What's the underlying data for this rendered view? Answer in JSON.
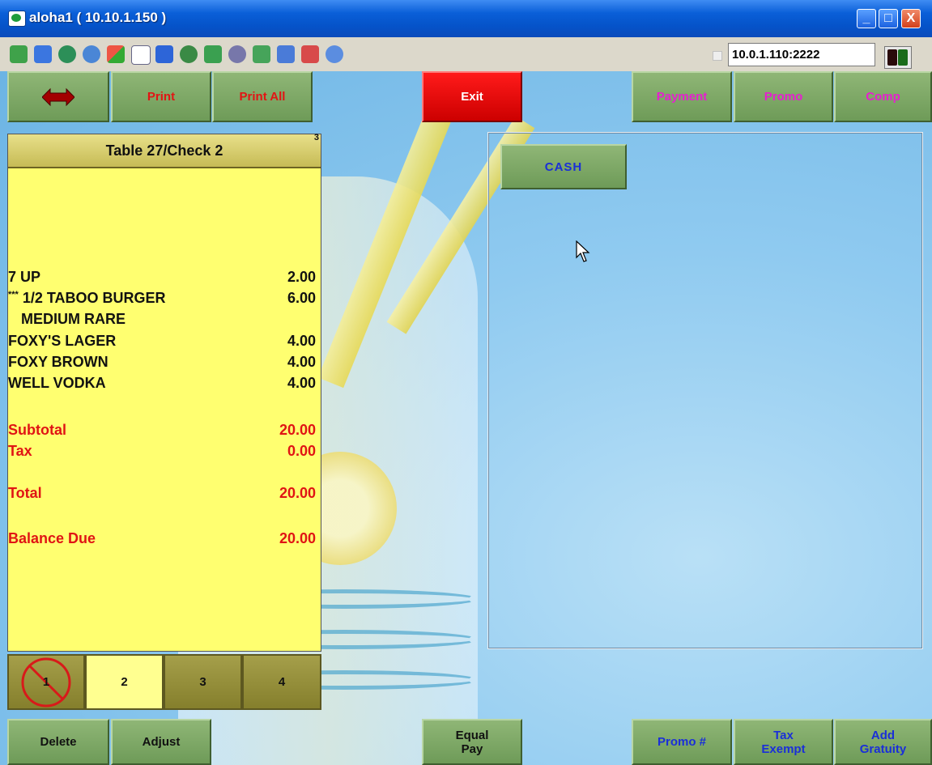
{
  "window": {
    "title": "aloha1 ( 10.10.1.150 )",
    "minimize": "_",
    "maximize": "□",
    "close": "X"
  },
  "toolbar": {
    "address": "10.0.1.110:2222",
    "icons": [
      "cycle-icon",
      "window-icon",
      "globe-icon",
      "refresh-icon",
      "windows-logo-icon",
      "abc-icon",
      "info-icon",
      "disconnect-icon",
      "transfer-icon",
      "tools-icon",
      "sync-icon",
      "screen-capture-icon",
      "screen-target-icon",
      "search-icon"
    ]
  },
  "top_buttons": {
    "print": "Print",
    "print_all": "Print All",
    "exit": "Exit",
    "payment": "Payment",
    "promo": "Promo",
    "comp": "Comp"
  },
  "check": {
    "header": "Table 27/Check 2",
    "corner_number": "3",
    "items": [
      {
        "name": "7 UP",
        "amount": "2.00"
      },
      {
        "prefix": "***",
        "name": " 1/2 TABOO BURGER",
        "amount": "6.00"
      },
      {
        "name": "MEDIUM RARE",
        "amount": ""
      },
      {
        "name": "FOXY'S LAGER",
        "amount": "4.00"
      },
      {
        "name": "FOXY BROWN",
        "amount": "4.00"
      },
      {
        "name": "WELL VODKA",
        "amount": "4.00"
      }
    ],
    "subtotal_label": "Subtotal",
    "subtotal": "20.00",
    "tax_label": "Tax",
    "tax": "0.00",
    "total_label": "Total",
    "total": "20.00",
    "balance_label": "Balance Due",
    "balance": "20.00"
  },
  "seats": [
    "1",
    "2",
    "3",
    "4"
  ],
  "payment_panel": {
    "cash": "CASH"
  },
  "bottom_buttons": {
    "delete": "Delete",
    "adjust": "Adjust",
    "equal_pay_1": "Equal",
    "equal_pay_2": "Pay",
    "promo_num": "Promo #",
    "tax_exempt_1": "Tax",
    "tax_exempt_2": "Exempt",
    "add_gratuity_1": "Add",
    "add_gratuity_2": "Gratuity"
  },
  "colors": {
    "check_bg": "#ffff70",
    "button_green": "#7aa763",
    "exit_red": "#e00000",
    "pink_text": "#e61fd0",
    "red_text": "#e01414"
  }
}
